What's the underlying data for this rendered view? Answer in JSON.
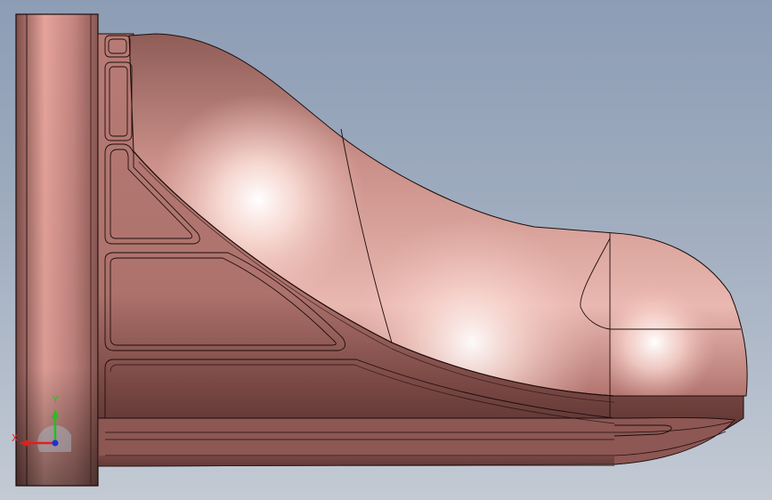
{
  "viewport": {
    "background_top": "#8d9db5",
    "background_bottom": "#c3cad4"
  },
  "model": {
    "body_color": "#c98f88",
    "edge_color": "#1c0e0c"
  },
  "triad": {
    "x_label": "X",
    "y_label": "Y",
    "x_color": "#e0201c",
    "y_color": "#22c022",
    "z_color": "#2030d8"
  }
}
